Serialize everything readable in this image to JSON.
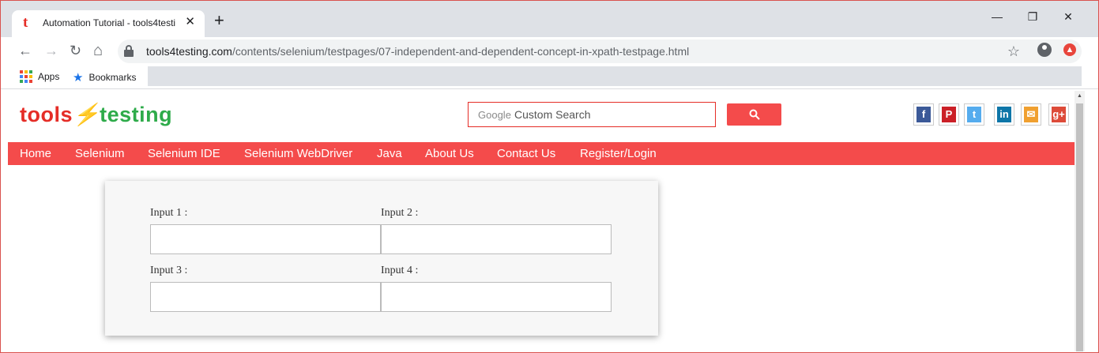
{
  "browser": {
    "tab_title": "Automation Tutorial - tools4testi",
    "tab_favicon": "t",
    "tab_close": "✕",
    "new_tab": "+",
    "window_controls": {
      "minimize": "—",
      "restore": "❐",
      "close": "✕"
    },
    "nav": {
      "back": "←",
      "forward": "→",
      "reload": "↻",
      "home": "⌂"
    },
    "url_host": "tools4testing.com",
    "url_path": "/contents/selenium/testpages/07-independent-and-dependent-concept-in-xpath-testpage.html",
    "bookmark_star": "☆",
    "extension_icon": "▲",
    "bookmarks": [
      {
        "label": "Apps",
        "icon": "apps-grid-icon"
      },
      {
        "label": "Bookmarks",
        "icon": "star-icon"
      }
    ],
    "apps_grid_colors": [
      "#ea4335",
      "#fbbc04",
      "#34a853",
      "#4285f4",
      "#ea4335",
      "#fbbc04",
      "#34a853",
      "#4285f4",
      "#ea4335"
    ]
  },
  "site": {
    "logo": {
      "part1": "tools",
      "bolt": "⚡",
      "part2": "testing"
    },
    "search": {
      "google_label": "Google",
      "placeholder": "Custom Search"
    },
    "social": [
      {
        "name": "facebook-icon",
        "glyph": "f",
        "color": "#3b5998"
      },
      {
        "name": "pinterest-icon",
        "glyph": "P",
        "color": "#cb2027"
      },
      {
        "name": "twitter-icon",
        "glyph": "t",
        "color": "#55acee"
      },
      {
        "name": "linkedin-icon",
        "glyph": "in",
        "color": "#0e76a8"
      },
      {
        "name": "email-icon",
        "glyph": "✉",
        "color": "#f0a030"
      },
      {
        "name": "google-plus-icon",
        "glyph": "g+",
        "color": "#dd4b39"
      }
    ],
    "nav": [
      "Home",
      "Selenium",
      "Selenium IDE",
      "Selenium WebDriver",
      "Java",
      "About Us",
      "Contact Us",
      "Register/Login"
    ],
    "form": {
      "input1_label": "Input 1 :",
      "input2_label": "Input 2 :",
      "input3_label": "Input 3 :",
      "input4_label": "Input 4 :",
      "input1_value": "",
      "input2_value": "",
      "input3_value": "",
      "input4_value": ""
    }
  }
}
